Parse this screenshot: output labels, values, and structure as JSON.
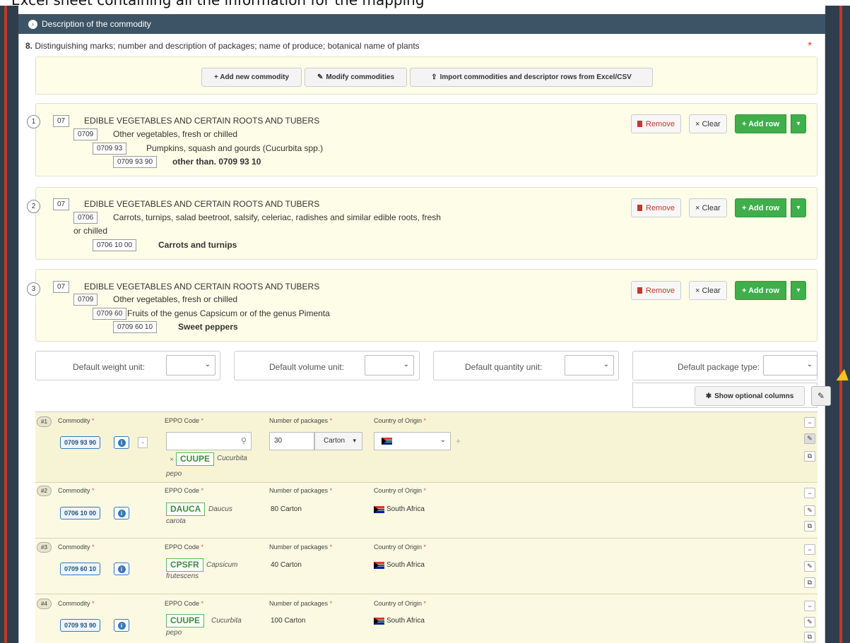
{
  "top_caption": "Excel sheet containing all the information for the mapping",
  "section": {
    "title": "Description of the commodity"
  },
  "question": {
    "number": "8.",
    "text": "Distinguishing marks; number and description of packages; name of produce; botanical name of plants",
    "required_mark": "*"
  },
  "toolbar": {
    "add_new": "+ Add new commodity",
    "modify": "Modify commodities",
    "import": "Import commodities and descriptor rows from Excel/CSV"
  },
  "commodities": [
    {
      "index": "1",
      "lines": [
        {
          "code": "07",
          "text": "EDIBLE VEGETABLES AND CERTAIN ROOTS AND TUBERS"
        },
        {
          "code": "0709",
          "text": "Other vegetables, fresh or chilled"
        },
        {
          "code": "0709 93",
          "text": "Pumpkins, squash and gourds (Cucurbita spp.)"
        },
        {
          "code": "0709 93 90",
          "text": "other than. 0709 93 10"
        }
      ]
    },
    {
      "index": "2",
      "lines": [
        {
          "code": "07",
          "text": "EDIBLE VEGETABLES AND CERTAIN ROOTS AND TUBERS"
        },
        {
          "code": "0706",
          "text": "Carrots, turnips, salad beetroot, salsify, celeriac, radishes and similar edible roots, fresh",
          "text2": "or chilled"
        },
        {
          "code": "0706 10 00",
          "text": "Carrots and turnips"
        }
      ]
    },
    {
      "index": "3",
      "lines": [
        {
          "code": "07",
          "text": "EDIBLE VEGETABLES AND CERTAIN ROOTS AND TUBERS"
        },
        {
          "code": "0709",
          "text": "Other vegetables, fresh or chilled"
        },
        {
          "code": "0709 60",
          "text": "Fruits of the genus Capsicum or of the genus Pimenta"
        },
        {
          "code": "0709 60 10",
          "text": "Sweet peppers"
        }
      ]
    }
  ],
  "row_actions": {
    "remove": "Remove",
    "clear": "Clear",
    "add_row": "+ Add row"
  },
  "defaults": {
    "weight": "Default weight unit:",
    "volume": "Default volume unit:",
    "quantity": "Default quantity unit:",
    "package": "Default package type:"
  },
  "show_optional": "Show optional columns",
  "columns": {
    "commodity": "Commodity",
    "eppo": "EPPO Code",
    "packages": "Number of packages",
    "origin": "Country of Origin",
    "star": "*"
  },
  "rows": [
    {
      "num": "#1",
      "commodity": "0709 93 90",
      "eppo": "CUUPE",
      "eppo_name_1": "Cucurbita",
      "eppo_name_2": "pepo",
      "remove_x": "×",
      "packages_value": "30",
      "package_type": "Carton",
      "origin": ""
    },
    {
      "num": "#2",
      "commodity": "0706 10 00",
      "eppo": "DAUCA",
      "eppo_name_1": "Daucus",
      "eppo_name_2": "carota",
      "packages": "80 Carton",
      "origin": "South Africa"
    },
    {
      "num": "#3",
      "commodity": "0709 60 10",
      "eppo": "CPSFR",
      "eppo_name_1": "Capsicum",
      "eppo_name_2": "frutescens",
      "packages": "40 Carton",
      "origin": "South Africa"
    },
    {
      "num": "#4",
      "commodity": "0709 93 90",
      "eppo": "CUUPE",
      "eppo_name_1": "Cucurbita",
      "eppo_name_2": "pepo",
      "packages": "100 Carton",
      "origin": "South Africa"
    }
  ],
  "colors": {
    "header": "#3d5466",
    "green": "#3fae4b",
    "remove_red": "#c0392b",
    "chip_blue": "#337ab7"
  }
}
